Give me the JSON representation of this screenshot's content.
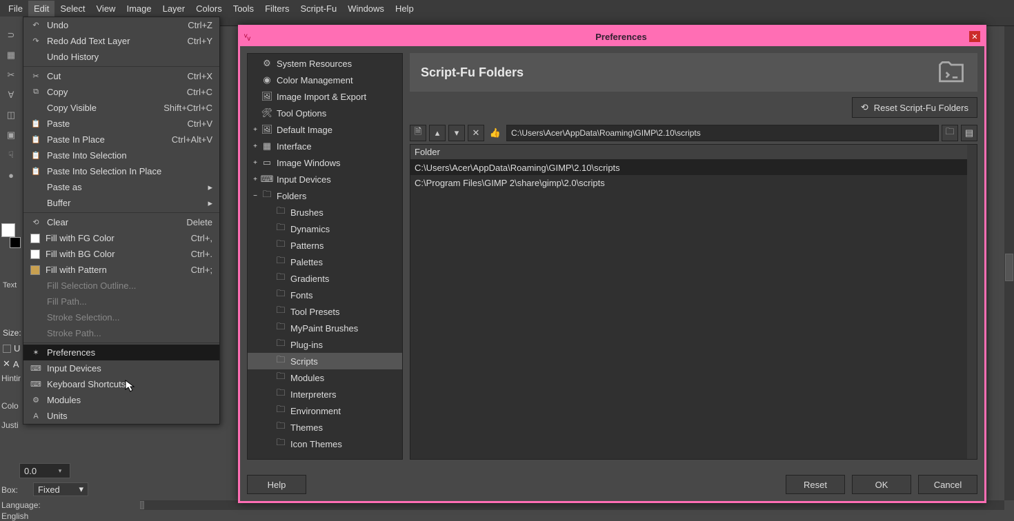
{
  "menubar": [
    "File",
    "Edit",
    "Select",
    "View",
    "Image",
    "Layer",
    "Colors",
    "Tools",
    "Filters",
    "Script-Fu",
    "Windows",
    "Help"
  ],
  "edit_menu": [
    {
      "icon": "↶",
      "label": "Undo",
      "short": "Ctrl+Z"
    },
    {
      "icon": "↷",
      "label": "Redo Add Text Layer",
      "short": "Ctrl+Y"
    },
    {
      "icon": "",
      "label": "Undo History",
      "short": ""
    },
    {
      "sep": true
    },
    {
      "icon": "✂",
      "label": "Cut",
      "short": "Ctrl+X"
    },
    {
      "icon": "⧉",
      "label": "Copy",
      "short": "Ctrl+C"
    },
    {
      "icon": "",
      "label": "Copy Visible",
      "short": "Shift+Ctrl+C"
    },
    {
      "icon": "📋",
      "label": "Paste",
      "short": "Ctrl+V"
    },
    {
      "icon": "📋",
      "label": "Paste In Place",
      "short": "Ctrl+Alt+V"
    },
    {
      "icon": "📋",
      "label": "Paste Into Selection",
      "short": ""
    },
    {
      "icon": "📋",
      "label": "Paste Into Selection In Place",
      "short": ""
    },
    {
      "icon": "",
      "label": "Paste as",
      "arrow": true
    },
    {
      "icon": "",
      "label": "Buffer",
      "arrow": true
    },
    {
      "sep": true
    },
    {
      "icon": "⟲",
      "label": "Clear",
      "short": "Delete"
    },
    {
      "swatch": "#fff",
      "label": "Fill with FG Color",
      "short": "Ctrl+,"
    },
    {
      "swatch": "#fff",
      "label": "Fill with BG Color",
      "short": "Ctrl+."
    },
    {
      "swatch": "#c8a050",
      "label": "Fill with Pattern",
      "short": "Ctrl+;"
    },
    {
      "icon": "",
      "label": "Fill Selection Outline...",
      "disabled": true
    },
    {
      "icon": "",
      "label": "Fill Path...",
      "disabled": true
    },
    {
      "icon": "",
      "label": "Stroke Selection...",
      "disabled": true
    },
    {
      "icon": "",
      "label": "Stroke Path...",
      "disabled": true
    },
    {
      "sep": true
    },
    {
      "icon": "✶",
      "label": "Preferences",
      "highlighted": true
    },
    {
      "icon": "⌨",
      "label": "Input Devices"
    },
    {
      "icon": "⌨",
      "label": "Keyboard Shortcuts"
    },
    {
      "icon": "⚙",
      "label": "Modules"
    },
    {
      "icon": "A",
      "label": "Units"
    }
  ],
  "tool_options": {
    "header": "Text",
    "size_label": "Size:",
    "use_editor": "U",
    "antialias": "A",
    "hinting": "Hintir",
    "color": "Colo",
    "justify": "Justi",
    "spin_value": "0.0",
    "box_label": "Box:",
    "box_value": "Fixed",
    "lang_label": "Language:",
    "lang_value": "English"
  },
  "pref": {
    "title": "Preferences",
    "tree": [
      {
        "exp": "",
        "ind": 0,
        "icon": "⚙",
        "label": "System Resources"
      },
      {
        "exp": "",
        "ind": 0,
        "icon": "◉",
        "label": "Color Management"
      },
      {
        "exp": "",
        "ind": 0,
        "icon": "🖼",
        "label": "Image Import & Export"
      },
      {
        "exp": "",
        "ind": 0,
        "icon": "🛠",
        "label": "Tool Options"
      },
      {
        "exp": "+",
        "ind": 0,
        "icon": "🖼",
        "label": "Default Image"
      },
      {
        "exp": "+",
        "ind": 0,
        "icon": "▦",
        "label": "Interface"
      },
      {
        "exp": "+",
        "ind": 0,
        "icon": "▭",
        "label": "Image Windows"
      },
      {
        "exp": "+",
        "ind": 0,
        "icon": "⌨",
        "label": "Input Devices"
      },
      {
        "exp": "−",
        "ind": 0,
        "icon": "🗀",
        "label": "Folders"
      },
      {
        "exp": "",
        "ind": 1,
        "icon": "🗀",
        "label": "Brushes"
      },
      {
        "exp": "",
        "ind": 1,
        "icon": "🗀",
        "label": "Dynamics"
      },
      {
        "exp": "",
        "ind": 1,
        "icon": "🗀",
        "label": "Patterns"
      },
      {
        "exp": "",
        "ind": 1,
        "icon": "🗀",
        "label": "Palettes"
      },
      {
        "exp": "",
        "ind": 1,
        "icon": "🗀",
        "label": "Gradients"
      },
      {
        "exp": "",
        "ind": 1,
        "icon": "🗀",
        "label": "Fonts"
      },
      {
        "exp": "",
        "ind": 1,
        "icon": "🗀",
        "label": "Tool Presets"
      },
      {
        "exp": "",
        "ind": 1,
        "icon": "🗀",
        "label": "MyPaint Brushes"
      },
      {
        "exp": "",
        "ind": 1,
        "icon": "🗀",
        "label": "Plug-ins"
      },
      {
        "exp": "",
        "ind": 1,
        "icon": "🗀",
        "label": "Scripts",
        "selected": true
      },
      {
        "exp": "",
        "ind": 1,
        "icon": "🗀",
        "label": "Modules"
      },
      {
        "exp": "",
        "ind": 1,
        "icon": "🗀",
        "label": "Interpreters"
      },
      {
        "exp": "",
        "ind": 1,
        "icon": "🗀",
        "label": "Environment"
      },
      {
        "exp": "",
        "ind": 1,
        "icon": "🗀",
        "label": "Themes"
      },
      {
        "exp": "",
        "ind": 1,
        "icon": "🗀",
        "label": "Icon Themes"
      }
    ],
    "header_title": "Script-Fu Folders",
    "reset_label": "Reset Script-Fu Folders",
    "path_value": "C:\\Users\\Acer\\AppData\\Roaming\\GIMP\\2.10\\scripts",
    "folder_header": "Folder",
    "folders": [
      {
        "path": "C:\\Users\\Acer\\AppData\\Roaming\\GIMP\\2.10\\scripts",
        "selected": true
      },
      {
        "path": "C:\\Program Files\\GIMP 2\\share\\gimp\\2.0\\scripts"
      }
    ],
    "buttons": {
      "help": "Help",
      "reset": "Reset",
      "ok": "OK",
      "cancel": "Cancel"
    }
  }
}
